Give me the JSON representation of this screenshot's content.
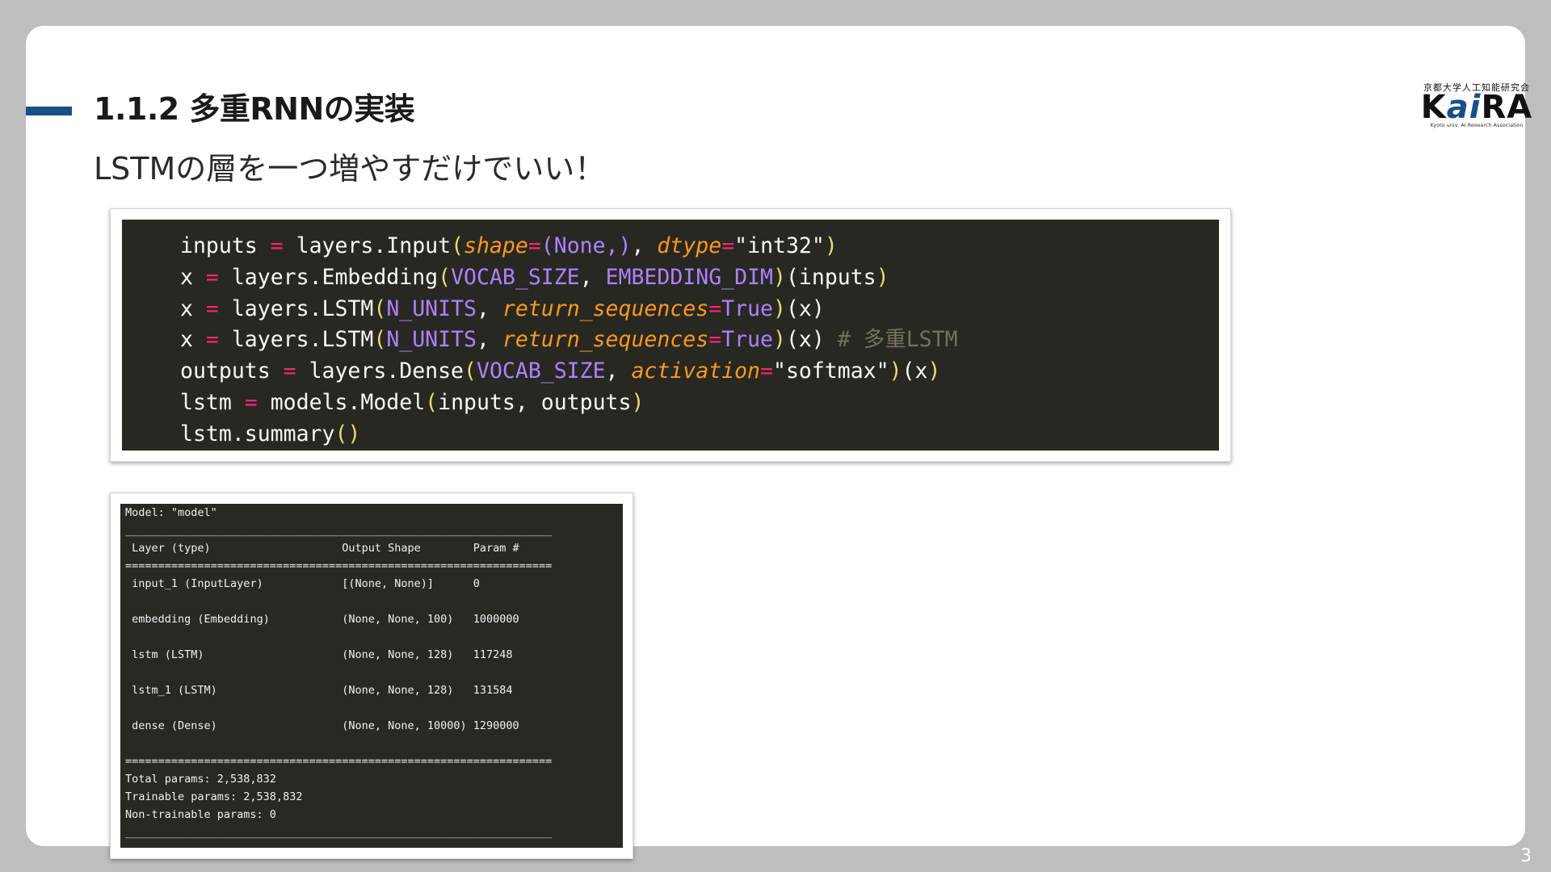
{
  "slide": {
    "title": "1.1.2 多重RNNの実装",
    "subtitle": "LSTMの層を一つ増やすだけでいい！",
    "page_number": "3",
    "accent_color": "#1a4e8a"
  },
  "logo": {
    "top_text": "京都大学人工知能研究会",
    "main_k": "K",
    "main_ai": "ai",
    "main_ra": "RA",
    "bottom_text": "Kyoto univ. AI Research Association"
  },
  "code": {
    "language": "python",
    "lines": [
      [
        {
          "t": "inputs ",
          "c": "pl"
        },
        {
          "t": "=",
          "c": "op"
        },
        {
          "t": " layers.Input",
          "c": "pl"
        },
        {
          "t": "(",
          "c": "br"
        },
        {
          "t": "shape",
          "c": "kw"
        },
        {
          "t": "=",
          "c": "op"
        },
        {
          "t": "(None,)",
          "c": "cn"
        },
        {
          "t": ", ",
          "c": "pl"
        },
        {
          "t": "dtype",
          "c": "kw"
        },
        {
          "t": "=",
          "c": "op"
        },
        {
          "t": "\"int32\"",
          "c": "st"
        },
        {
          "t": ")",
          "c": "br"
        }
      ],
      [
        {
          "t": "x ",
          "c": "pl"
        },
        {
          "t": "=",
          "c": "op"
        },
        {
          "t": " layers.Embedding",
          "c": "pl"
        },
        {
          "t": "(",
          "c": "br"
        },
        {
          "t": "VOCAB_SIZE",
          "c": "cn"
        },
        {
          "t": ", ",
          "c": "pl"
        },
        {
          "t": "EMBEDDING_DIM",
          "c": "cn"
        },
        {
          "t": ")",
          "c": "br"
        },
        {
          "t": "(inputs",
          "c": "pl"
        },
        {
          "t": ")",
          "c": "br"
        }
      ],
      [
        {
          "t": "x ",
          "c": "pl"
        },
        {
          "t": "=",
          "c": "op"
        },
        {
          "t": " layers.LSTM",
          "c": "pl"
        },
        {
          "t": "(",
          "c": "br"
        },
        {
          "t": "N_UNITS",
          "c": "cn"
        },
        {
          "t": ", ",
          "c": "pl"
        },
        {
          "t": "return_sequences",
          "c": "kw"
        },
        {
          "t": "=",
          "c": "op"
        },
        {
          "t": "True",
          "c": "cn"
        },
        {
          "t": ")",
          "c": "br"
        },
        {
          "t": "(x)",
          "c": "pl"
        }
      ],
      [
        {
          "t": "x ",
          "c": "pl"
        },
        {
          "t": "=",
          "c": "op"
        },
        {
          "t": " layers.LSTM",
          "c": "pl"
        },
        {
          "t": "(",
          "c": "br"
        },
        {
          "t": "N_UNITS",
          "c": "cn"
        },
        {
          "t": ", ",
          "c": "pl"
        },
        {
          "t": "return_sequences",
          "c": "kw"
        },
        {
          "t": "=",
          "c": "op"
        },
        {
          "t": "True",
          "c": "cn"
        },
        {
          "t": ")",
          "c": "br"
        },
        {
          "t": "(x) ",
          "c": "pl"
        },
        {
          "t": "# 多重LSTM",
          "c": "cm"
        }
      ],
      [
        {
          "t": "outputs ",
          "c": "pl"
        },
        {
          "t": "=",
          "c": "op"
        },
        {
          "t": " layers.Dense",
          "c": "pl"
        },
        {
          "t": "(",
          "c": "br"
        },
        {
          "t": "VOCAB_SIZE",
          "c": "cn"
        },
        {
          "t": ", ",
          "c": "pl"
        },
        {
          "t": "activation",
          "c": "kw"
        },
        {
          "t": "=",
          "c": "op"
        },
        {
          "t": "\"softmax\"",
          "c": "st"
        },
        {
          "t": ")",
          "c": "br"
        },
        {
          "t": "(x",
          "c": "pl"
        },
        {
          "t": ")",
          "c": "br"
        }
      ],
      [
        {
          "t": "lstm ",
          "c": "pl"
        },
        {
          "t": "=",
          "c": "op"
        },
        {
          "t": " models.Model",
          "c": "pl"
        },
        {
          "t": "(",
          "c": "br"
        },
        {
          "t": "inputs, outputs",
          "c": "pl"
        },
        {
          "t": ")",
          "c": "br"
        }
      ],
      [
        {
          "t": "lstm.summary",
          "c": "pl"
        },
        {
          "t": "()",
          "c": "br"
        }
      ]
    ]
  },
  "model_summary": {
    "model_line": "Model: \"model\"",
    "rule_single": "_________________________________________________________________",
    "rule_double": "=================================================================",
    "header": {
      "layer": "Layer (type)",
      "shape": "Output Shape",
      "params": "Param #"
    },
    "rows": [
      {
        "layer": "input_1 (InputLayer)",
        "shape": "[(None, None)]",
        "params": "0"
      },
      {
        "layer": "embedding (Embedding)",
        "shape": "(None, None, 100)",
        "params": "1000000"
      },
      {
        "layer": "lstm (LSTM)",
        "shape": "(None, None, 128)",
        "params": "117248"
      },
      {
        "layer": "lstm_1 (LSTM)",
        "shape": "(None, None, 128)",
        "params": "131584"
      },
      {
        "layer": "dense (Dense)",
        "shape": "(None, None, 10000)",
        "params": "1290000"
      }
    ],
    "total": "Total params: 2,538,832",
    "trainable": "Trainable params: 2,538,832",
    "non_trainable": "Non-trainable params: 0"
  }
}
